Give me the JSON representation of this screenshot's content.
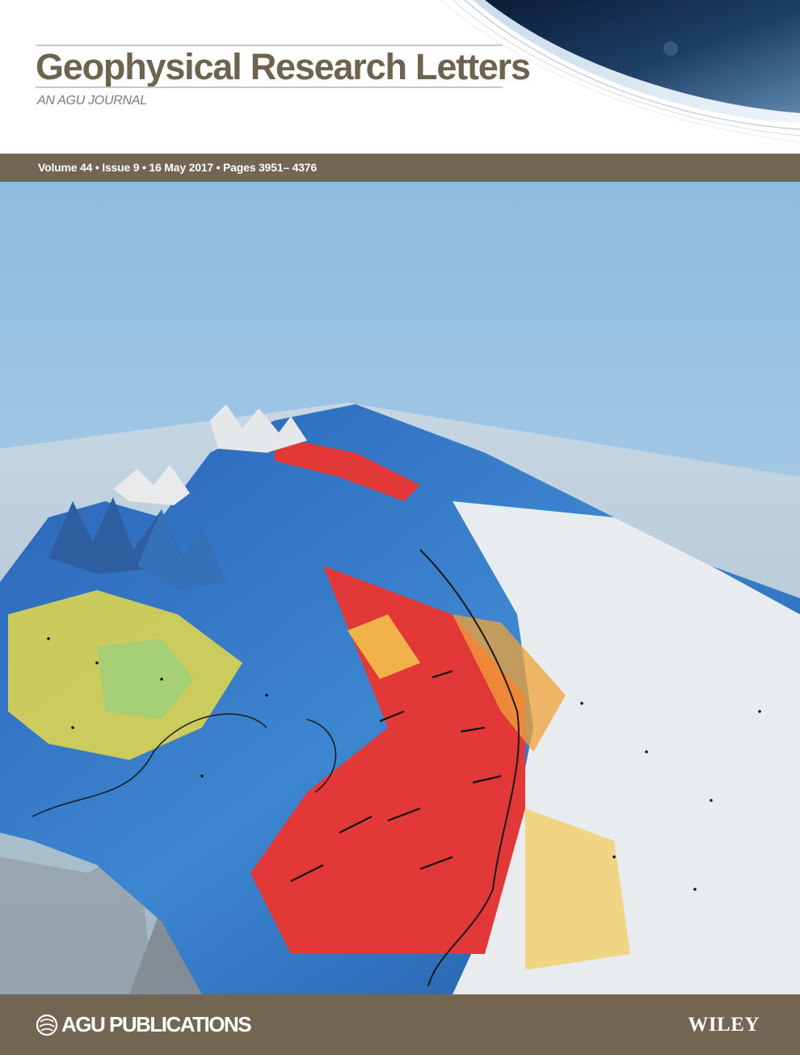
{
  "journal": {
    "title": "Geophysical Research Letters",
    "subtitle": "AN AGU JOURNAL"
  },
  "issue": {
    "info": "Volume 44 • Issue 9 • 16 May 2017 • Pages 3951– 4376"
  },
  "footer": {
    "publisher": "AGU PUBLICATIONS",
    "wiley": "WILEY"
  },
  "colors": {
    "brand_brown": "#736753",
    "title_brown": "#6e6250",
    "sky": "#a9cbe4",
    "ocean": "#c2d4e0",
    "ice_shelf_red": "#e33838",
    "glacier_blue": "#2a63b8",
    "snow_white": "#e9ecee"
  },
  "icons": {
    "publisher": "agu-globe-icon",
    "earth": "earth-horizon-arc-icon"
  }
}
